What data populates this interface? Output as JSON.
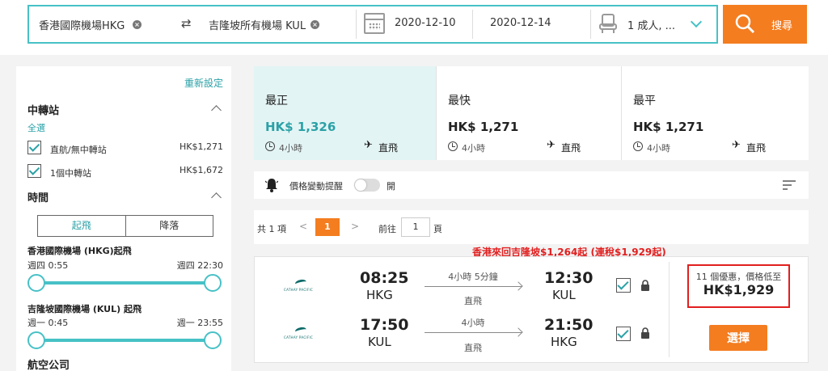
{
  "search": {
    "origin": "香港國際機場HKG",
    "destination": "吉隆坡所有機場 KUL",
    "depart_date": "2020-12-10",
    "return_date": "2020-12-14",
    "passengers": "1 成人, ...",
    "search_label": "搜尋"
  },
  "filters": {
    "reset_label": "重新設定",
    "stops": {
      "title": "中轉站",
      "select_all": "全選",
      "options": [
        {
          "label": "直航/無中轉站",
          "price": "HK$1,271"
        },
        {
          "label": "1個中轉站",
          "price": "HK$1,672"
        }
      ]
    },
    "times": {
      "title": "時間",
      "tabs": [
        "起飛",
        "降落"
      ],
      "groups": [
        {
          "title": "香港國際機場 (HKG)起飛",
          "from": "週四 0:55",
          "to": "週四 22:30"
        },
        {
          "title": "吉隆坡國際機場 (KUL) 起飛",
          "from": "週一 0:45",
          "to": "週一 23:55"
        }
      ]
    },
    "airline_title": "航空公司"
  },
  "tabs": [
    {
      "title": "最正",
      "price": "HK$ 1,326",
      "duration": "4小時",
      "stop": "直飛"
    },
    {
      "title": "最快",
      "price": "HK$ 1,271",
      "duration": "4小時",
      "stop": "直飛"
    },
    {
      "title": "最平",
      "price": "HK$ 1,271",
      "duration": "4小時",
      "stop": "直飛"
    }
  ],
  "alert": {
    "label": "價格變動提醒",
    "state": "開"
  },
  "pagination": {
    "total": "共 1 項",
    "prev": "<",
    "next": ">",
    "current": "1",
    "goto": "前往",
    "goto_value": "1",
    "unit": "頁"
  },
  "promo": "香港來回吉隆坡$1,264起 (連稅$1,929起)",
  "result": {
    "airline_logo_text": "CATHAY PACIFIC",
    "legs": [
      {
        "dep_time": "08:25",
        "dep_code": "HKG",
        "duration": "4小時 5分鐘",
        "stop": "直飛",
        "arr_time": "12:30",
        "arr_code": "KUL"
      },
      {
        "dep_time": "17:50",
        "dep_code": "KUL",
        "duration": "4小時",
        "stop": "直飛",
        "arr_time": "21:50",
        "arr_code": "HKG"
      }
    ],
    "offer_count": "11 個優惠，價格低至",
    "offer_price": "HK$1,929",
    "select_label": "選擇"
  },
  "colors": {
    "accent": "#47c1c6",
    "orange": "#f47d20",
    "red": "#e21f1f"
  }
}
